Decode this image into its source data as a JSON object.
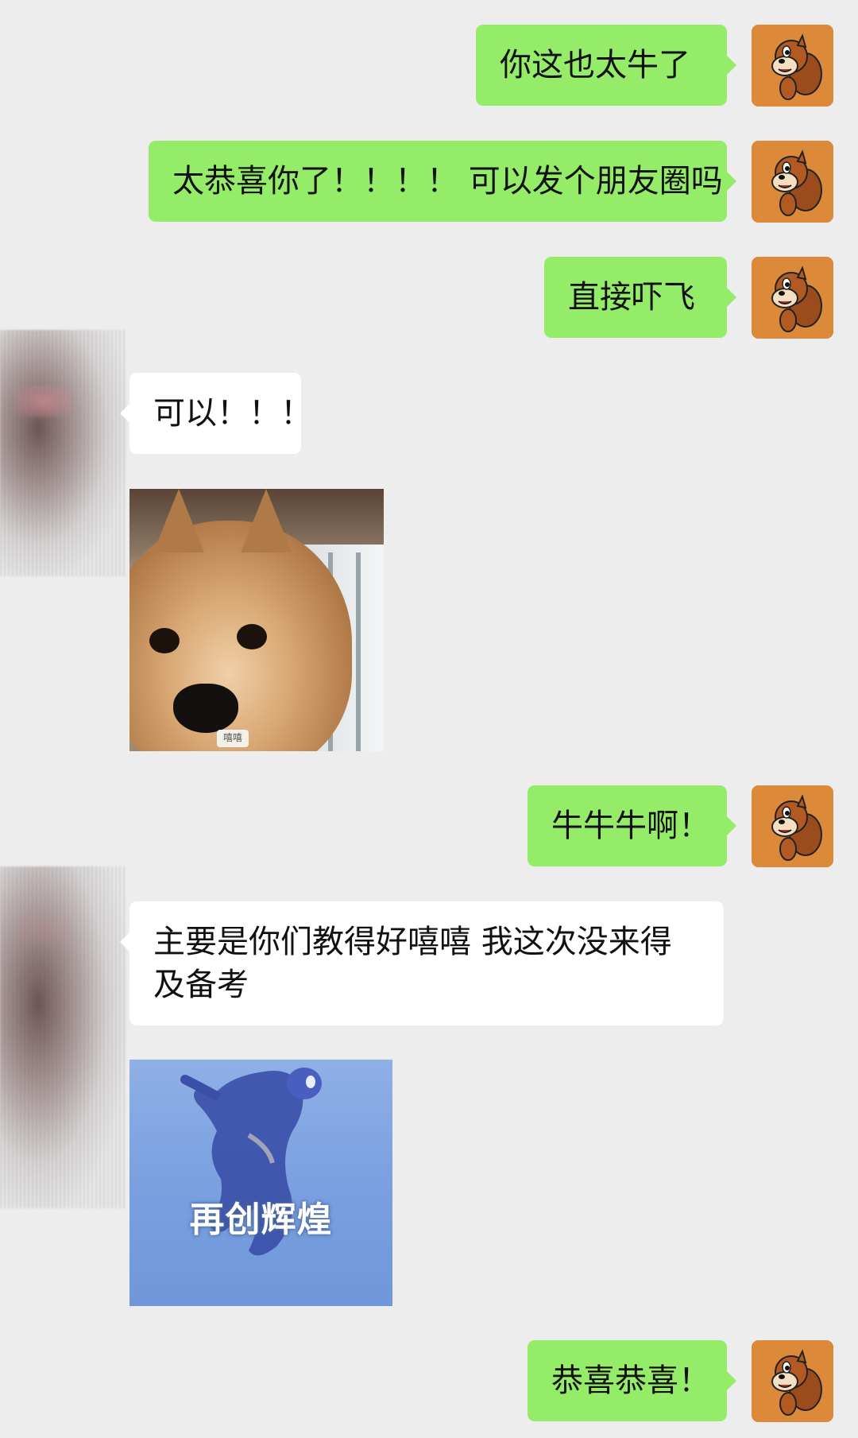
{
  "colors": {
    "background": "#ededed",
    "outgoing_bubble": "#95ec69",
    "incoming_bubble": "#ffffff",
    "my_avatar_bg": "#dc8a3a"
  },
  "my_avatar": {
    "icon": "chipmunk-avatar-icon"
  },
  "peer_avatar": {
    "icon": "blurred-profile-photo"
  },
  "messages": [
    {
      "from": "me",
      "text": "你这也太牛了"
    },
    {
      "from": "me",
      "text": "太恭喜你了！！！！ 可以发个朋友圈吗"
    },
    {
      "from": "me",
      "text": "直接吓飞"
    },
    {
      "from": "peer",
      "text": "可以！！！"
    },
    {
      "from": "peer",
      "sticker": "shiba-dog-sticker",
      "sticker_caption": "嘻嘻"
    },
    {
      "from": "me",
      "text": "牛牛牛啊！"
    },
    {
      "from": "peer",
      "text": "主要是你们教得好嘻嘻 我这次没来得及备考"
    },
    {
      "from": "peer",
      "sticker": "ultraman-sticker",
      "sticker_caption": "再创辉煌"
    },
    {
      "from": "me",
      "text": "恭喜恭喜！"
    }
  ]
}
